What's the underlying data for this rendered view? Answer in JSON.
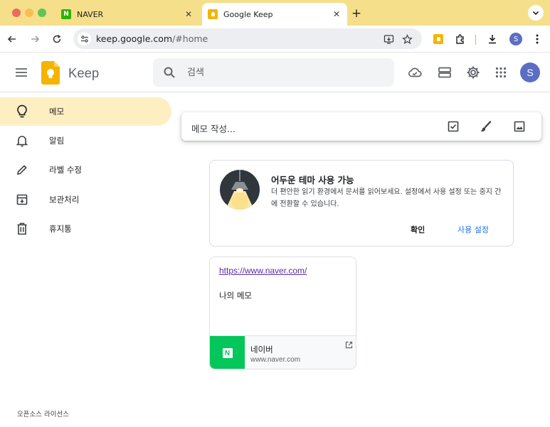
{
  "browser": {
    "tabs": [
      {
        "label": "NAVER",
        "favicon": "naver-favicon"
      },
      {
        "label": "Google Keep",
        "favicon": "keep-favicon"
      }
    ],
    "url_host": "keep.google.com",
    "url_path": "/#home",
    "avatar_letter": "S"
  },
  "header": {
    "app_name": "Keep",
    "search_placeholder": "검색",
    "avatar_letter": "S",
    "avatar_color": "#5b6ec4"
  },
  "sidebar": {
    "items": [
      {
        "label": "메모",
        "icon": "lightbulb-icon",
        "active": true
      },
      {
        "label": "알림",
        "icon": "bell-icon"
      },
      {
        "label": "라벨 수정",
        "icon": "pencil-icon"
      },
      {
        "label": "보관처리",
        "icon": "archive-icon"
      },
      {
        "label": "휴지통",
        "icon": "trash-icon"
      }
    ],
    "active_color": "#feefc3",
    "footer": "오픈소스 라이선스"
  },
  "take_note": {
    "placeholder": "메모 작성..."
  },
  "promo": {
    "title": "어두운 테마 사용 가능",
    "body": "더 편안한 읽기 환경에서 문서를 읽어보세요. 설정에서 사용 설정 또는 중지 간에 전환할 수 있습니다.",
    "confirm_label": "확인",
    "settings_label": "사용 설정"
  },
  "note": {
    "link": "https://www.naver.com/",
    "text": "나의 메모",
    "preview_title": "네이버",
    "preview_domain": "www.naver.com",
    "preview_color": "#03c75a"
  }
}
